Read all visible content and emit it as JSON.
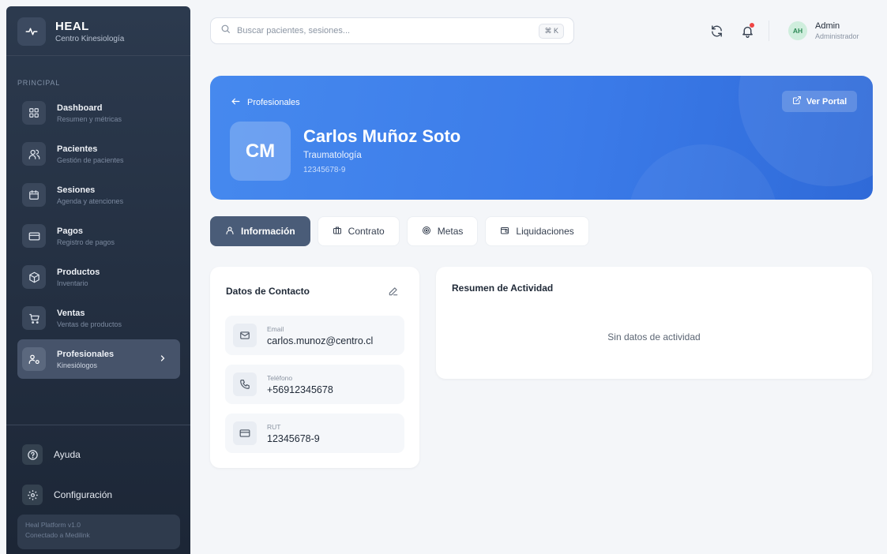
{
  "brand": {
    "name": "HEAL",
    "subtitle": "Centro Kinesiología"
  },
  "sidebar": {
    "section_label": "PRINCIPAL",
    "items": [
      {
        "title": "Dashboard",
        "subtitle": "Resumen y métricas",
        "icon": "dashboard-grid-icon"
      },
      {
        "title": "Pacientes",
        "subtitle": "Gestión de pacientes",
        "icon": "users-icon"
      },
      {
        "title": "Sesiones",
        "subtitle": "Agenda y atenciones",
        "icon": "calendar-icon"
      },
      {
        "title": "Pagos",
        "subtitle": "Registro de pagos",
        "icon": "credit-card-icon"
      },
      {
        "title": "Productos",
        "subtitle": "Inventario",
        "icon": "package-icon"
      },
      {
        "title": "Ventas",
        "subtitle": "Ventas de productos",
        "icon": "cart-icon"
      },
      {
        "title": "Profesionales",
        "subtitle": "Kinesiólogos",
        "icon": "professionals-icon",
        "active": true
      }
    ],
    "help_label": "Ayuda",
    "settings_label": "Configuración",
    "footer_line1": "Heal Platform v1.0",
    "footer_line2": "Conectado a Medilink"
  },
  "topbar": {
    "search_placeholder": "Buscar pacientes, sesiones...",
    "search_shortcut": "⌘ K",
    "user_initials": "AH",
    "user_name": "Admin",
    "user_role": "Administrador"
  },
  "hero": {
    "back_label": "Profesionales",
    "portal_label": "Ver Portal",
    "initials": "CM",
    "name": "Carlos Muñoz Soto",
    "specialty": "Traumatología",
    "rut": "12345678-9"
  },
  "tabs": [
    {
      "label": "Información",
      "icon": "user-icon",
      "active": true
    },
    {
      "label": "Contrato",
      "icon": "briefcase-icon"
    },
    {
      "label": "Metas",
      "icon": "target-icon"
    },
    {
      "label": "Liquidaciones",
      "icon": "wallet-icon"
    }
  ],
  "contact": {
    "title": "Datos de Contacto",
    "email_label": "Email",
    "email_value": "carlos.munoz@centro.cl",
    "phone_label": "Teléfono",
    "phone_value": "+56912345678",
    "rut_label": "RUT",
    "rut_value": "12345678-9"
  },
  "activity": {
    "title": "Resumen de Actividad",
    "empty_text": "Sin datos de actividad"
  },
  "colors": {
    "sidebar_top": "#2c3a4e",
    "sidebar_bottom": "#1c2636",
    "hero_blue": "#3b7be9",
    "active_tab": "#4a5c78",
    "notification": "#ef4444"
  }
}
